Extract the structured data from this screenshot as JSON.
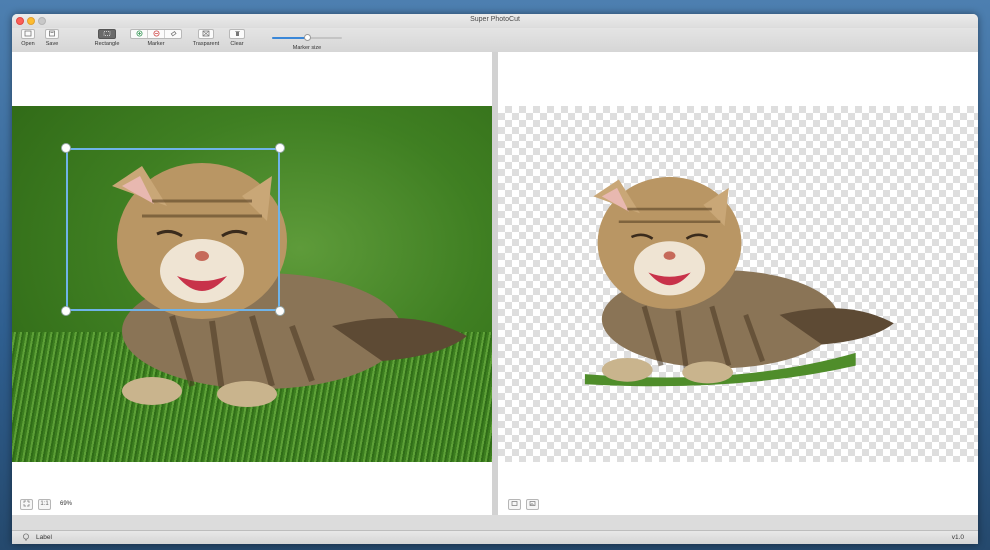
{
  "window": {
    "title": "Super PhotoCut"
  },
  "toolbar": {
    "open_label": "Open",
    "save_label": "Save",
    "rectangle_label": "Rectangle",
    "marker_label": "Marker",
    "transparent_label": "Trasparent",
    "clear_label": "Clear",
    "marker_size_label": "Marker size",
    "marker_size_value": 0.5
  },
  "left_pane": {
    "zoom": "69%",
    "fit_label": "1:1"
  },
  "status": {
    "label": "Label",
    "version": "v1.0"
  },
  "colors": {
    "accent": "#3a87d8",
    "selection": "#6fb3e8"
  }
}
